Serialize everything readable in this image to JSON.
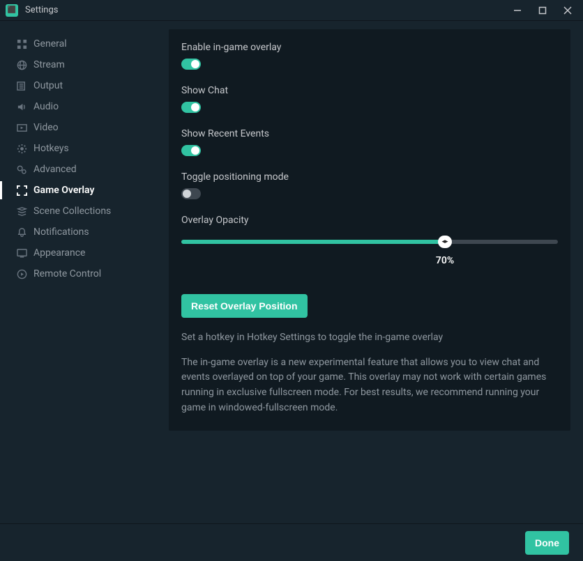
{
  "window": {
    "title": "Settings"
  },
  "sidebar": {
    "items": [
      {
        "id": "general",
        "label": "General",
        "active": false
      },
      {
        "id": "stream",
        "label": "Stream",
        "active": false
      },
      {
        "id": "output",
        "label": "Output",
        "active": false
      },
      {
        "id": "audio",
        "label": "Audio",
        "active": false
      },
      {
        "id": "video",
        "label": "Video",
        "active": false
      },
      {
        "id": "hotkeys",
        "label": "Hotkeys",
        "active": false
      },
      {
        "id": "advanced",
        "label": "Advanced",
        "active": false
      },
      {
        "id": "game-overlay",
        "label": "Game Overlay",
        "active": true
      },
      {
        "id": "scene-collections",
        "label": "Scene Collections",
        "active": false
      },
      {
        "id": "notifications",
        "label": "Notifications",
        "active": false
      },
      {
        "id": "appearance",
        "label": "Appearance",
        "active": false
      },
      {
        "id": "remote-control",
        "label": "Remote Control",
        "active": false
      }
    ]
  },
  "settings": {
    "enable_overlay": {
      "label": "Enable in-game overlay",
      "value": true
    },
    "show_chat": {
      "label": "Show Chat",
      "value": true
    },
    "show_events": {
      "label": "Show Recent Events",
      "value": true
    },
    "positioning": {
      "label": "Toggle positioning mode",
      "value": false
    },
    "opacity": {
      "label": "Overlay Opacity",
      "value": 70,
      "display": "70%",
      "min": 0,
      "max": 100
    },
    "reset_button": "Reset Overlay Position",
    "hint1": "Set a hotkey in Hotkey Settings to toggle the in-game overlay",
    "hint2": "The in-game overlay is a new experimental feature that allows you to view chat and events overlayed on top of your game. This overlay may not work with certain games running in exclusive fullscreen mode. For best results, we recommend running your game in windowed-fullscreen mode."
  },
  "footer": {
    "done": "Done"
  }
}
